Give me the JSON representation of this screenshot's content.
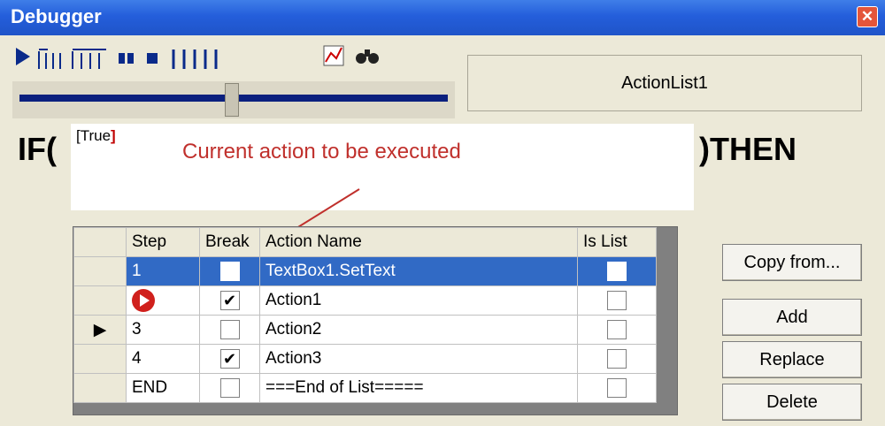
{
  "window": {
    "title": "Debugger",
    "close_icon": "close-icon"
  },
  "toolbar": {
    "icons": [
      "play-icon",
      "step-icon",
      "step-over-icon",
      "pause-icon",
      "stop-icon",
      "run-to-end-icon",
      "chart-icon",
      "binoculars-icon"
    ]
  },
  "action_list_name": "ActionList1",
  "condition": {
    "if_label": "IF(",
    "then_label": ")THEN",
    "value_open": "[True",
    "value_close": "]"
  },
  "annotation": "Current action to be executed",
  "grid": {
    "headers": {
      "step": "Step",
      "break": "Break",
      "action_name": "Action Name",
      "is_list": "Is List"
    },
    "rows": [
      {
        "step": "1",
        "action": "TextBox1.SetText",
        "break": false,
        "selected": true
      },
      {
        "step": "",
        "action": "Action1",
        "break": true,
        "current": true
      },
      {
        "step": "3",
        "action": "Action2",
        "break": false,
        "indicator": "▶"
      },
      {
        "step": "4",
        "action": "Action3",
        "break": true
      },
      {
        "step": "END",
        "action": "===End of List=====",
        "break": false
      }
    ]
  },
  "buttons": {
    "copy_from": "Copy from...",
    "add": "Add",
    "replace": "Replace",
    "delete": "Delete"
  }
}
